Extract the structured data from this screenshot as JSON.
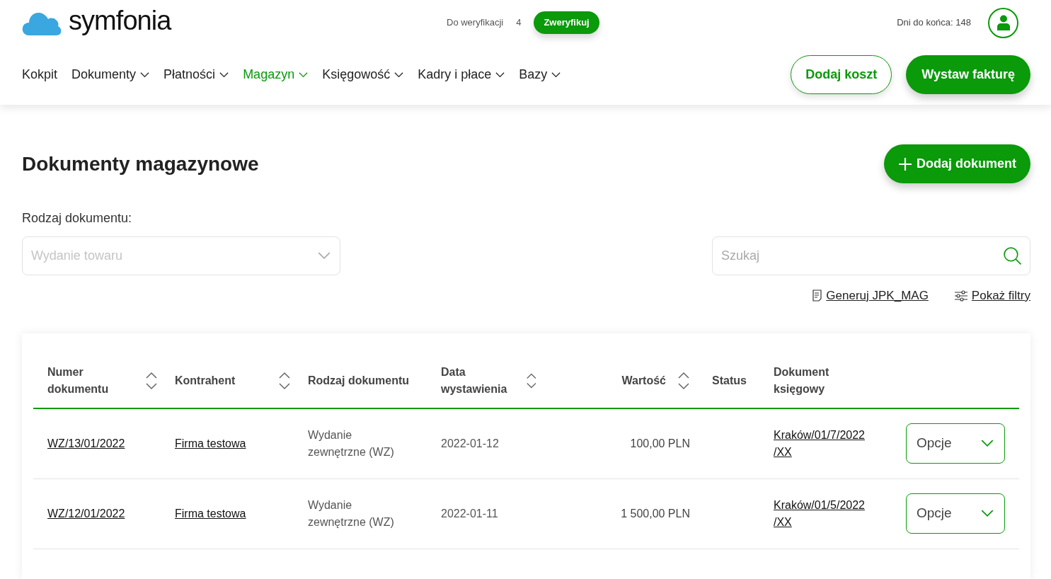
{
  "header": {
    "logo": "symfonia",
    "verify_label": "Do weryfikacji",
    "verify_count": "4",
    "verify_button": "Zweryfikuj",
    "days_left": "Dni do końca: 148"
  },
  "nav": [
    {
      "label": "Kokpit",
      "dropdown": false,
      "selected": false
    },
    {
      "label": "Dokumenty",
      "dropdown": true,
      "selected": false
    },
    {
      "label": "Płatności",
      "dropdown": true,
      "selected": false
    },
    {
      "label": "Magazyn",
      "dropdown": true,
      "selected": true
    },
    {
      "label": "Księgowość",
      "dropdown": true,
      "selected": false
    },
    {
      "label": "Kadry i płace",
      "dropdown": true,
      "selected": false
    },
    {
      "label": "Bazy",
      "dropdown": true,
      "selected": false
    }
  ],
  "actions": [
    {
      "label": "Dodaj koszt",
      "kind": "outline"
    },
    {
      "label": "Wystaw fakturę",
      "kind": "filled"
    }
  ],
  "page": {
    "title": "Dokumenty magazynowe",
    "add_button": "Dodaj dokument",
    "type_label": "Rodzaj dokumentu:",
    "type_value": "Wydanie towaru",
    "search_placeholder": "Szukaj",
    "links": [
      {
        "label": "Generuj JPK_MAG",
        "kind": "document"
      },
      {
        "label": "Pokaż filtry",
        "kind": "filters"
      }
    ]
  },
  "table": {
    "columns": [
      {
        "label": "Numer dokumentu",
        "sortable": true
      },
      {
        "label": "Kontrahent",
        "sortable": true
      },
      {
        "label": "Rodzaj dokumentu",
        "sortable": false
      },
      {
        "label": "Data wystawienia",
        "sortable": true
      },
      {
        "label": "Wartość",
        "sortable": true
      },
      {
        "label": "Status",
        "sortable": false
      },
      {
        "label": "Dokument księgowy",
        "sortable": false
      }
    ],
    "rows": [
      {
        "number": "WZ/13/01/2022",
        "contractor": "Firma testowa",
        "type": "Wydanie zewnętrzne (WZ)",
        "date": "2022-01-12",
        "value": "100,00 PLN",
        "ledger_doc": "Kraków/01/7/2022 /XX",
        "options": "Opcje"
      },
      {
        "number": "WZ/12/01/2022",
        "contractor": "Firma testowa",
        "type": "Wydanie zewnętrzne (WZ)",
        "date": "2022-01-11",
        "value": "1 500,00 PLN",
        "ledger_doc": "Kraków/01/5/2022 /XX",
        "options": "Opcje"
      }
    ]
  }
}
